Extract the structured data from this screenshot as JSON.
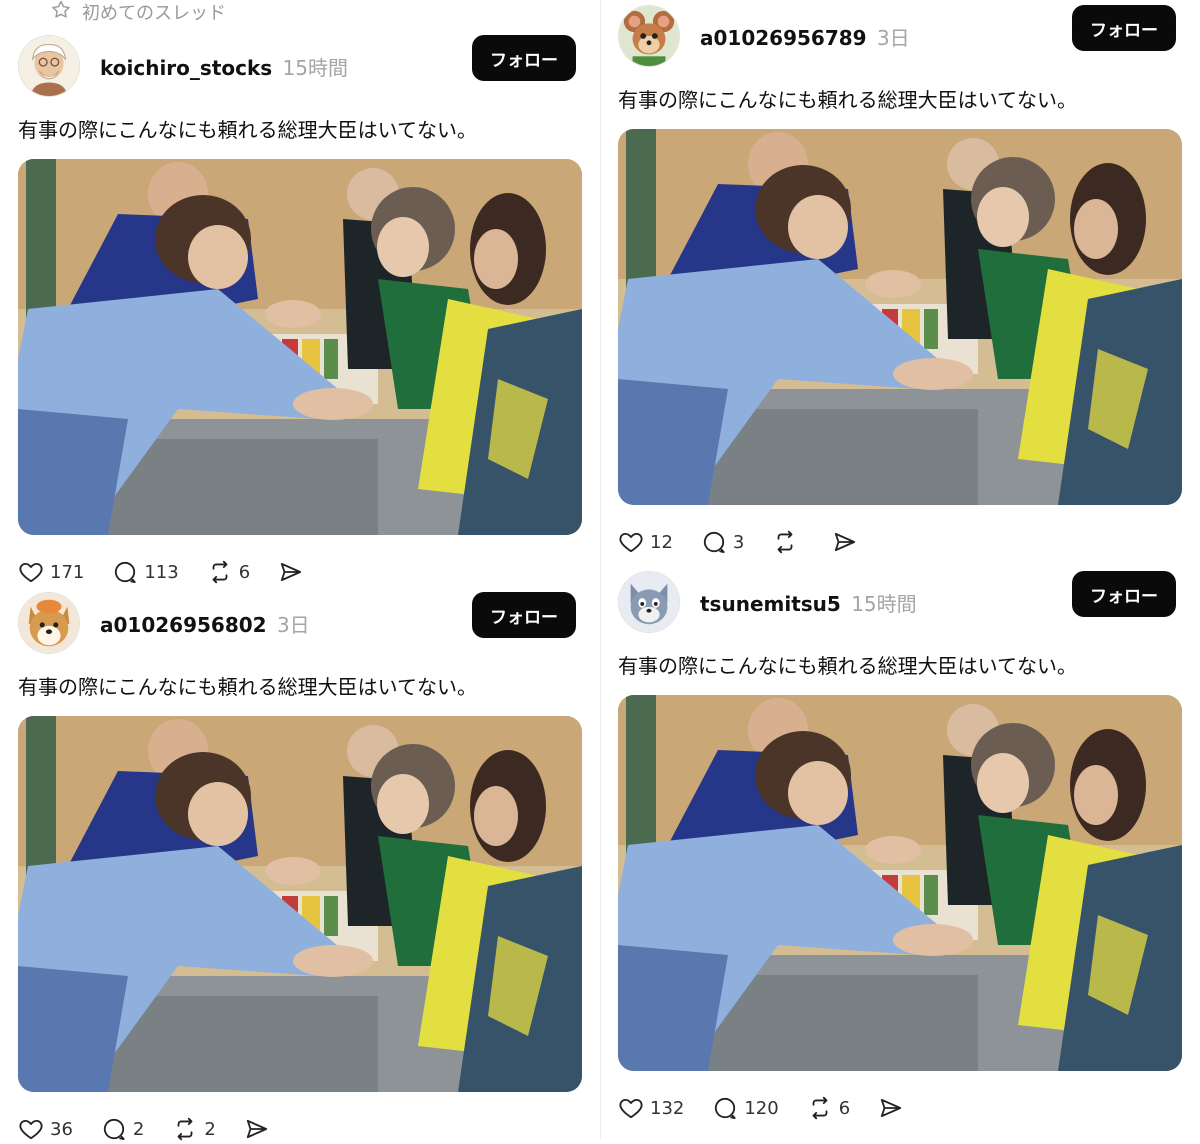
{
  "header": {
    "title": "初めてのスレッド"
  },
  "posts": [
    {
      "username": "koichiro_stocks",
      "time": "15時間",
      "follow_label": "フォロー",
      "text": "有事の際にこんなにも頼れる総理大臣はいてない。",
      "likes": "171",
      "replies": "113",
      "reposts": "6",
      "avatar_icon": "old-man-illustration-avatar"
    },
    {
      "username": "a01026956789",
      "time": "3日",
      "follow_label": "フォロー",
      "text": "有事の際にこんなにも頼れる総理大臣はいてない。",
      "likes": "12",
      "replies": "3",
      "reposts": "",
      "avatar_icon": "cartoon-mouse-avatar"
    },
    {
      "username": "a01026956802",
      "time": "3日",
      "follow_label": "フォロー",
      "text": "有事の際にこんなにも頼れる総理大臣はいてない。",
      "likes": "36",
      "replies": "2",
      "reposts": "2",
      "avatar_icon": "shiba-dog-avatar"
    },
    {
      "username": "tsunemitsu5",
      "time": "15時間",
      "follow_label": "フォロー",
      "text": "有事の際にこんなにも頼れる総理大臣はいてない。",
      "likes": "132",
      "replies": "120",
      "reposts": "6",
      "avatar_icon": "cartoon-cat-avatar"
    }
  ],
  "colors": {
    "follow_bg": "#0a0a0a",
    "follow_text": "#ffffff",
    "muted_text": "#a5a5a5"
  }
}
